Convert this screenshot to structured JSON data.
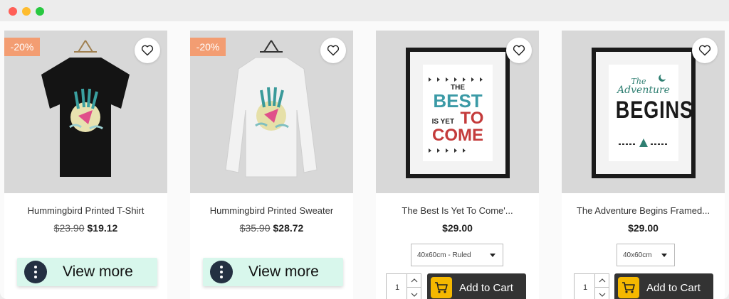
{
  "window": {
    "controls": [
      "close",
      "minimize",
      "maximize"
    ]
  },
  "products": [
    {
      "name": "Hummingbird Printed T-Shirt",
      "badge": "-20%",
      "old_price": "$23.90",
      "price": "$19.12",
      "action": "View more",
      "image": "black-tshirt-hummingbird"
    },
    {
      "name": "Hummingbird Printed Sweater",
      "badge": "-20%",
      "old_price": "$35.90",
      "price": "$28.72",
      "action": "View more",
      "image": "white-sweater-hummingbird"
    },
    {
      "name": "The Best Is Yet To Come'...",
      "price": "$29.00",
      "variant": "40x60cm - Ruled",
      "quantity": "1",
      "action": "Add to Cart",
      "image": "framed-poster-best-is-yet-to-come",
      "poster_text": [
        "THE",
        "BEST",
        "IS YET",
        "TO",
        "COME"
      ]
    },
    {
      "name": "The Adventure Begins Framed...",
      "price": "$29.00",
      "variant": "40x60cm",
      "quantity": "1",
      "action": "Add to Cart",
      "image": "framed-poster-adventure-begins",
      "poster_text": [
        "The",
        "Adventure",
        "BEGINS"
      ]
    }
  ],
  "colors": {
    "badge": "#f39d72",
    "view_more_bg": "#d8f7ec",
    "add_to_cart_bg": "#333333",
    "cart_icon": "#f5b800",
    "image_bg": "#d8d8d8"
  },
  "icons": {
    "wishlist": "heart-outline-icon",
    "view_more": "more-vertical-icon",
    "cart": "shopping-cart-icon"
  }
}
